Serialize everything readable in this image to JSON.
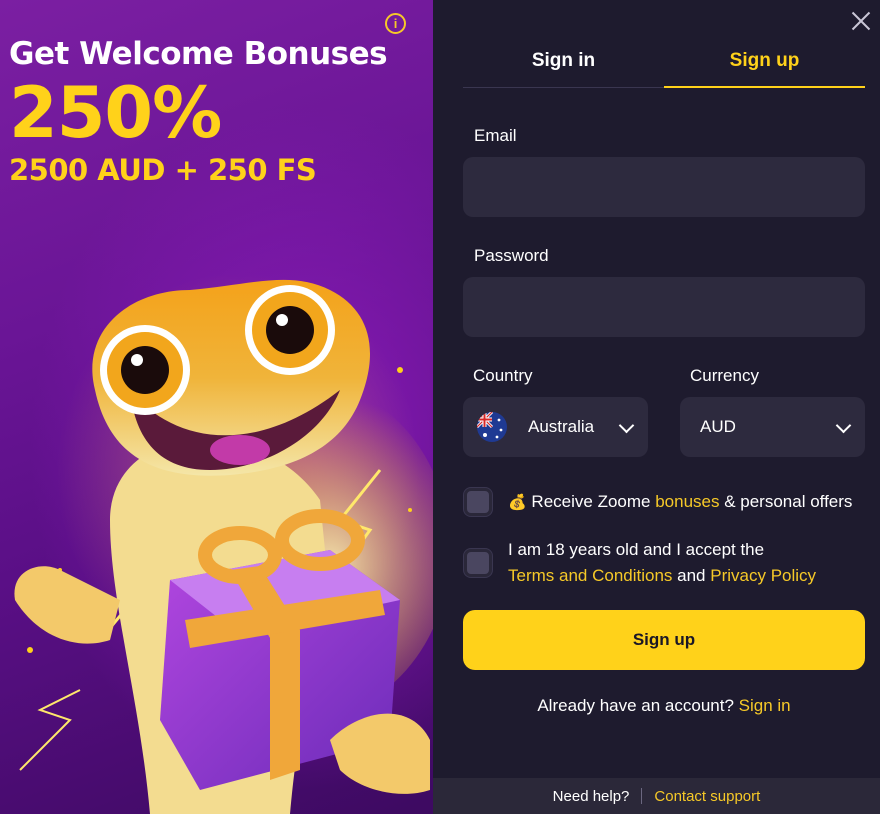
{
  "promo": {
    "title": "Get Welcome Bonuses",
    "percent": "250%",
    "subtitle": "2500 AUD + 250 FS",
    "info_icon": "info-circle-icon",
    "mascot_icon": "gecko-with-gift-illustration"
  },
  "tabs": [
    {
      "label": "Sign in",
      "active": false
    },
    {
      "label": "Sign up",
      "active": true
    }
  ],
  "form": {
    "email_label": "Email",
    "email_value": "",
    "password_label": "Password",
    "password_value": "",
    "country_label": "Country",
    "country_value": "Australia",
    "country_flag_icon": "australia-flag-icon",
    "currency_label": "Currency",
    "currency_value": "AUD",
    "bonus_checkbox": {
      "checked": false,
      "emoji_icon": "money-bag-icon",
      "text_before": "Receive Zoome ",
      "link": "bonuses",
      "text_after": " & personal offers"
    },
    "terms_checkbox": {
      "checked": false,
      "line1": "I am 18 years old and I accept the",
      "terms_link": "Terms and Conditions",
      "and": " and ",
      "privacy_link": "Privacy Policy"
    },
    "submit_label": "Sign up",
    "already_text": "Already have an account? ",
    "signin_link": "Sign in"
  },
  "footer": {
    "help": "Need help?",
    "contact": "Contact support"
  },
  "colors": {
    "accent": "#ffd21a",
    "panel_bg": "#1e1b2e",
    "field_bg": "#2d2a3e",
    "promo_purple": "#7b1fa2"
  }
}
